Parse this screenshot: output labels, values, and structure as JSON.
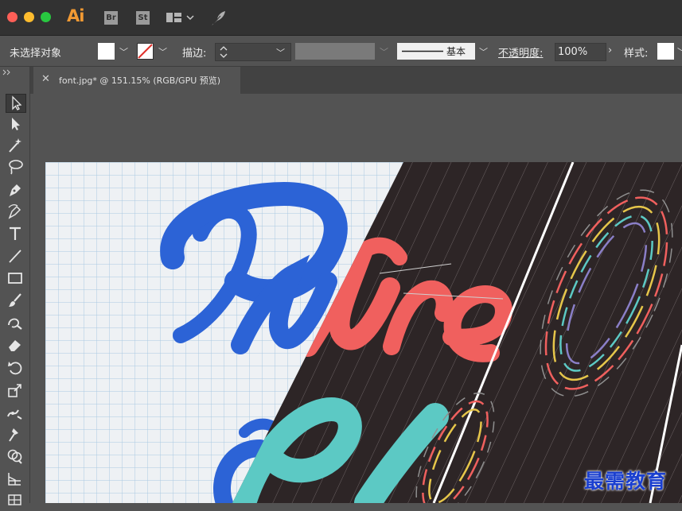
{
  "titlebar": {
    "app_logo": "Ai",
    "bridge_label": "Br",
    "stock_label": "St",
    "icons": [
      "workspace-switcher-icon",
      "feather-icon"
    ]
  },
  "controlbar": {
    "selection_status": "未选择对象",
    "stroke_label": "描边:",
    "brush_label": "基本",
    "opacity_label": "不透明度:",
    "opacity_value": "100%",
    "style_label": "样式:"
  },
  "document": {
    "tab_title": "font.jpg* @ 151.15% (RGB/GPU 预览)"
  },
  "tools": [
    "selection-tool-icon",
    "direct-selection-tool-icon",
    "magic-wand-tool-icon",
    "lasso-tool-icon",
    "pen-tool-icon",
    "curvature-tool-icon",
    "type-tool-icon",
    "line-tool-icon",
    "rectangle-tool-icon",
    "paintbrush-tool-icon",
    "shaper-tool-icon",
    "eraser-tool-icon",
    "rotate-tool-icon",
    "scale-tool-icon",
    "width-tool-icon",
    "puppet-warp-tool-icon",
    "shape-builder-tool-icon",
    "perspective-grid-tool-icon",
    "mesh-tool-icon"
  ],
  "colors": {
    "app_logo": "#f29a33",
    "fill_swatch": "#ffffff",
    "stroke_none": "#e0302a",
    "lettering_blue": "#2c63d6",
    "lettering_red": "#f0605e",
    "lettering_teal": "#5cc9c4",
    "artboard_dark": "#2d2526"
  },
  "watermark": "最需教育"
}
